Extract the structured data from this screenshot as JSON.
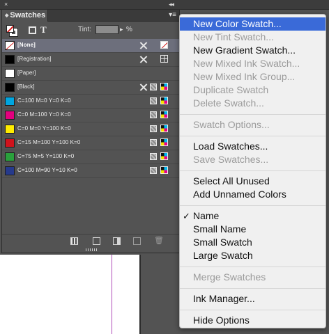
{
  "panel": {
    "tab_title": "Swatches",
    "flyout_label": "▾≡",
    "dock_collapse": "◂◂",
    "dock_close": "×",
    "tint_label": "Tint:",
    "tint_unit": "%",
    "tint_value": ""
  },
  "swatches": [
    {
      "name": "[None]",
      "color": "#ffffff",
      "kind": "none",
      "selected": true
    },
    {
      "name": "[Registration]",
      "color": "#000000",
      "kind": "registration"
    },
    {
      "name": "[Paper]",
      "color": "#ffffff",
      "kind": "paper"
    },
    {
      "name": "[Black]",
      "color": "#000000",
      "kind": "process"
    },
    {
      "name": "C=100 M=0 Y=0 K=0",
      "color": "#00a6e0",
      "kind": "process"
    },
    {
      "name": "C=0 M=100 Y=0 K=0",
      "color": "#e3007e",
      "kind": "process"
    },
    {
      "name": "C=0 M=0 Y=100 K=0",
      "color": "#ffec00",
      "kind": "process"
    },
    {
      "name": "C=15 M=100 Y=100 K=0",
      "color": "#d0131c",
      "kind": "process"
    },
    {
      "name": "C=75 M=5 Y=100 K=0",
      "color": "#2aa13c",
      "kind": "process"
    },
    {
      "name": "C=100 M=90 Y=10 K=0",
      "color": "#263a8c",
      "kind": "process"
    }
  ],
  "menu": {
    "items": [
      {
        "label": "New Color Swatch...",
        "state": "highlighted"
      },
      {
        "label": "New Tint Swatch...",
        "state": "disabled"
      },
      {
        "label": "New Gradient Swatch...",
        "state": "enabled"
      },
      {
        "label": "New Mixed Ink Swatch...",
        "state": "disabled"
      },
      {
        "label": "New Mixed Ink Group...",
        "state": "disabled"
      },
      {
        "label": "Duplicate Swatch",
        "state": "disabled"
      },
      {
        "label": "Delete Swatch...",
        "state": "disabled"
      },
      {
        "separator": true
      },
      {
        "label": "Swatch Options...",
        "state": "disabled"
      },
      {
        "separator": true
      },
      {
        "label": "Load Swatches...",
        "state": "enabled"
      },
      {
        "label": "Save Swatches...",
        "state": "disabled"
      },
      {
        "separator": true
      },
      {
        "label": "Select All Unused",
        "state": "enabled"
      },
      {
        "label": "Add Unnamed Colors",
        "state": "enabled"
      },
      {
        "separator": true
      },
      {
        "label": "Name",
        "state": "enabled",
        "checked": true
      },
      {
        "label": "Small Name",
        "state": "enabled"
      },
      {
        "label": "Small Swatch",
        "state": "enabled"
      },
      {
        "label": "Large Swatch",
        "state": "enabled"
      },
      {
        "separator": true
      },
      {
        "label": "Merge Swatches",
        "state": "disabled"
      },
      {
        "separator": true
      },
      {
        "label": "Ink Manager...",
        "state": "enabled"
      },
      {
        "separator": true
      },
      {
        "label": "Hide Options",
        "state": "enabled"
      }
    ],
    "check_glyph": "✓"
  }
}
